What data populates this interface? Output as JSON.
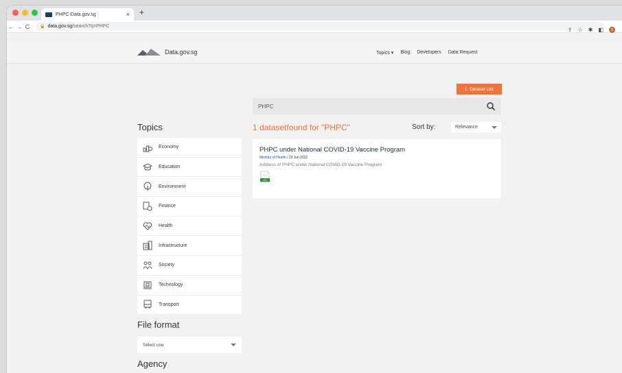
{
  "browser": {
    "tab_title": "PHPC-Data.gov.sg",
    "tab_close": "×",
    "new_tab": "+",
    "url_host": "data.gov.sg",
    "url_path": "/search?q=PHPC",
    "profile_initial": "S"
  },
  "site": {
    "logo_text": "Data.gov.sg",
    "nav": [
      "Topics ▾",
      "Blog",
      "Developers",
      "Data Request"
    ]
  },
  "actions": {
    "dataset_list": "Dataset List"
  },
  "search": {
    "value": "PHPC"
  },
  "topics": {
    "title": "Topics",
    "items": [
      {
        "label": "Economy",
        "icon": "economy-icon"
      },
      {
        "label": "Education",
        "icon": "education-icon"
      },
      {
        "label": "Environment",
        "icon": "environment-icon"
      },
      {
        "label": "Finance",
        "icon": "finance-icon"
      },
      {
        "label": "Health",
        "icon": "health-icon"
      },
      {
        "label": "Infrastructure",
        "icon": "infrastructure-icon"
      },
      {
        "label": "Society",
        "icon": "society-icon"
      },
      {
        "label": "Technology",
        "icon": "technology-icon"
      },
      {
        "label": "Transport",
        "icon": "transport-icon"
      }
    ]
  },
  "filters": {
    "file_format_title": "File format",
    "file_format_selected": "Select one",
    "agency_title": "Agency"
  },
  "results": {
    "count_text": "1 datasetfound for \"PHPC\"",
    "sort_label": "Sort by:",
    "sort_value": "Relevance",
    "items": [
      {
        "title": "PHPC under National COVID-19 Vaccine Program",
        "agency": "Ministry of Health",
        "date": " / 29 Jun 2022",
        "description": "Address of PHPC under National COVID-19 Vaccine Program",
        "format": "CSV"
      }
    ]
  },
  "colors": {
    "accent": "#f3733b",
    "csv_green": "#2e8b3e"
  }
}
